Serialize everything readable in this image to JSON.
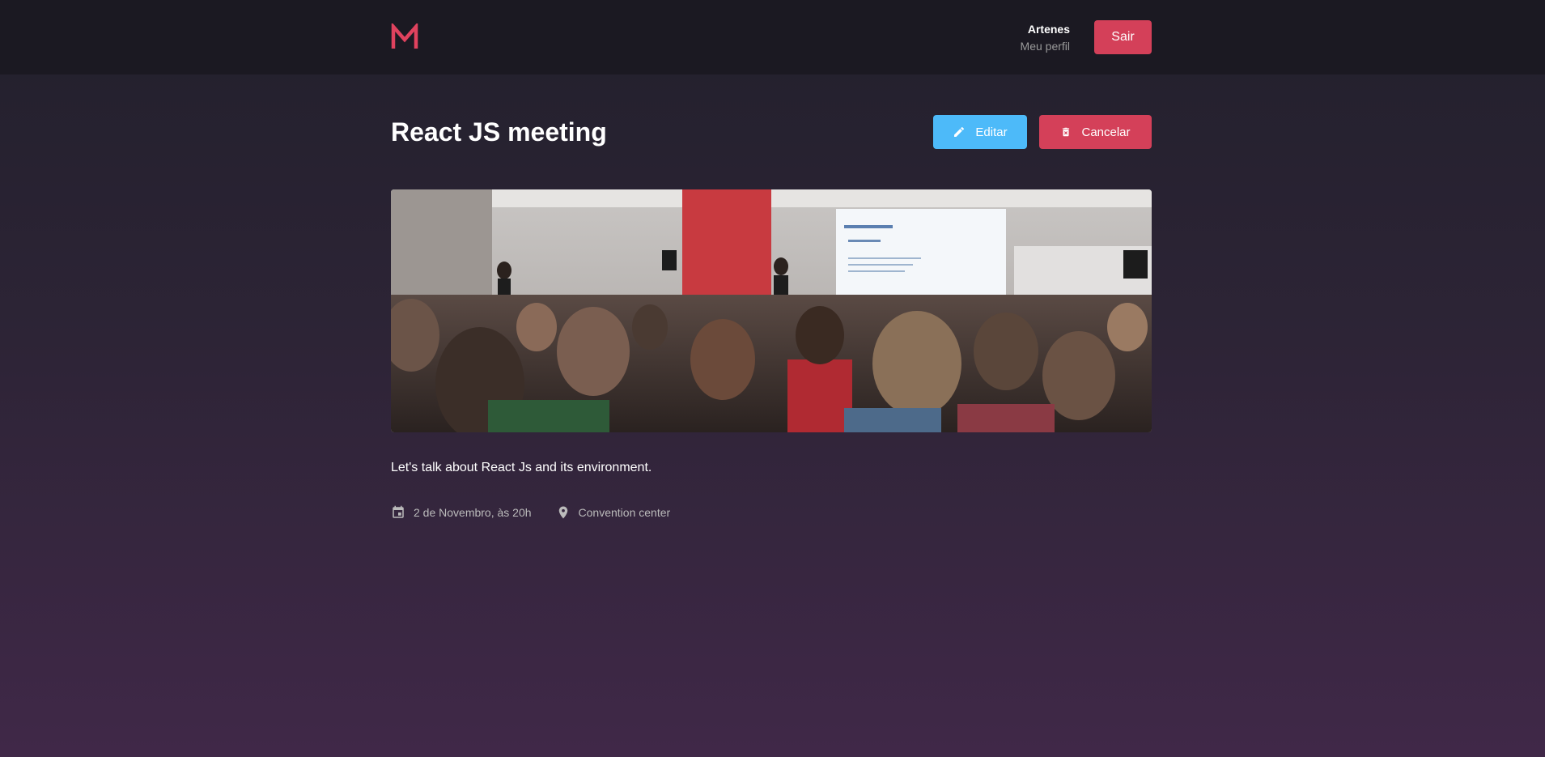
{
  "header": {
    "user_name": "Artenes",
    "profile_link": "Meu perfil",
    "exit_label": "Sair"
  },
  "meetup": {
    "title": "React JS meeting",
    "edit_label": "Editar",
    "cancel_label": "Cancelar",
    "description": "Let's talk about React Js and its environment.",
    "date": "2 de Novembro, às 20h",
    "location": "Convention center"
  },
  "colors": {
    "accent": "#d44059",
    "edit": "#4dbaf9"
  },
  "icons": {
    "logo": "m-logo",
    "edit": "pencil-icon",
    "cancel": "trash-icon",
    "date": "calendar-icon",
    "location": "location-pin-icon"
  }
}
